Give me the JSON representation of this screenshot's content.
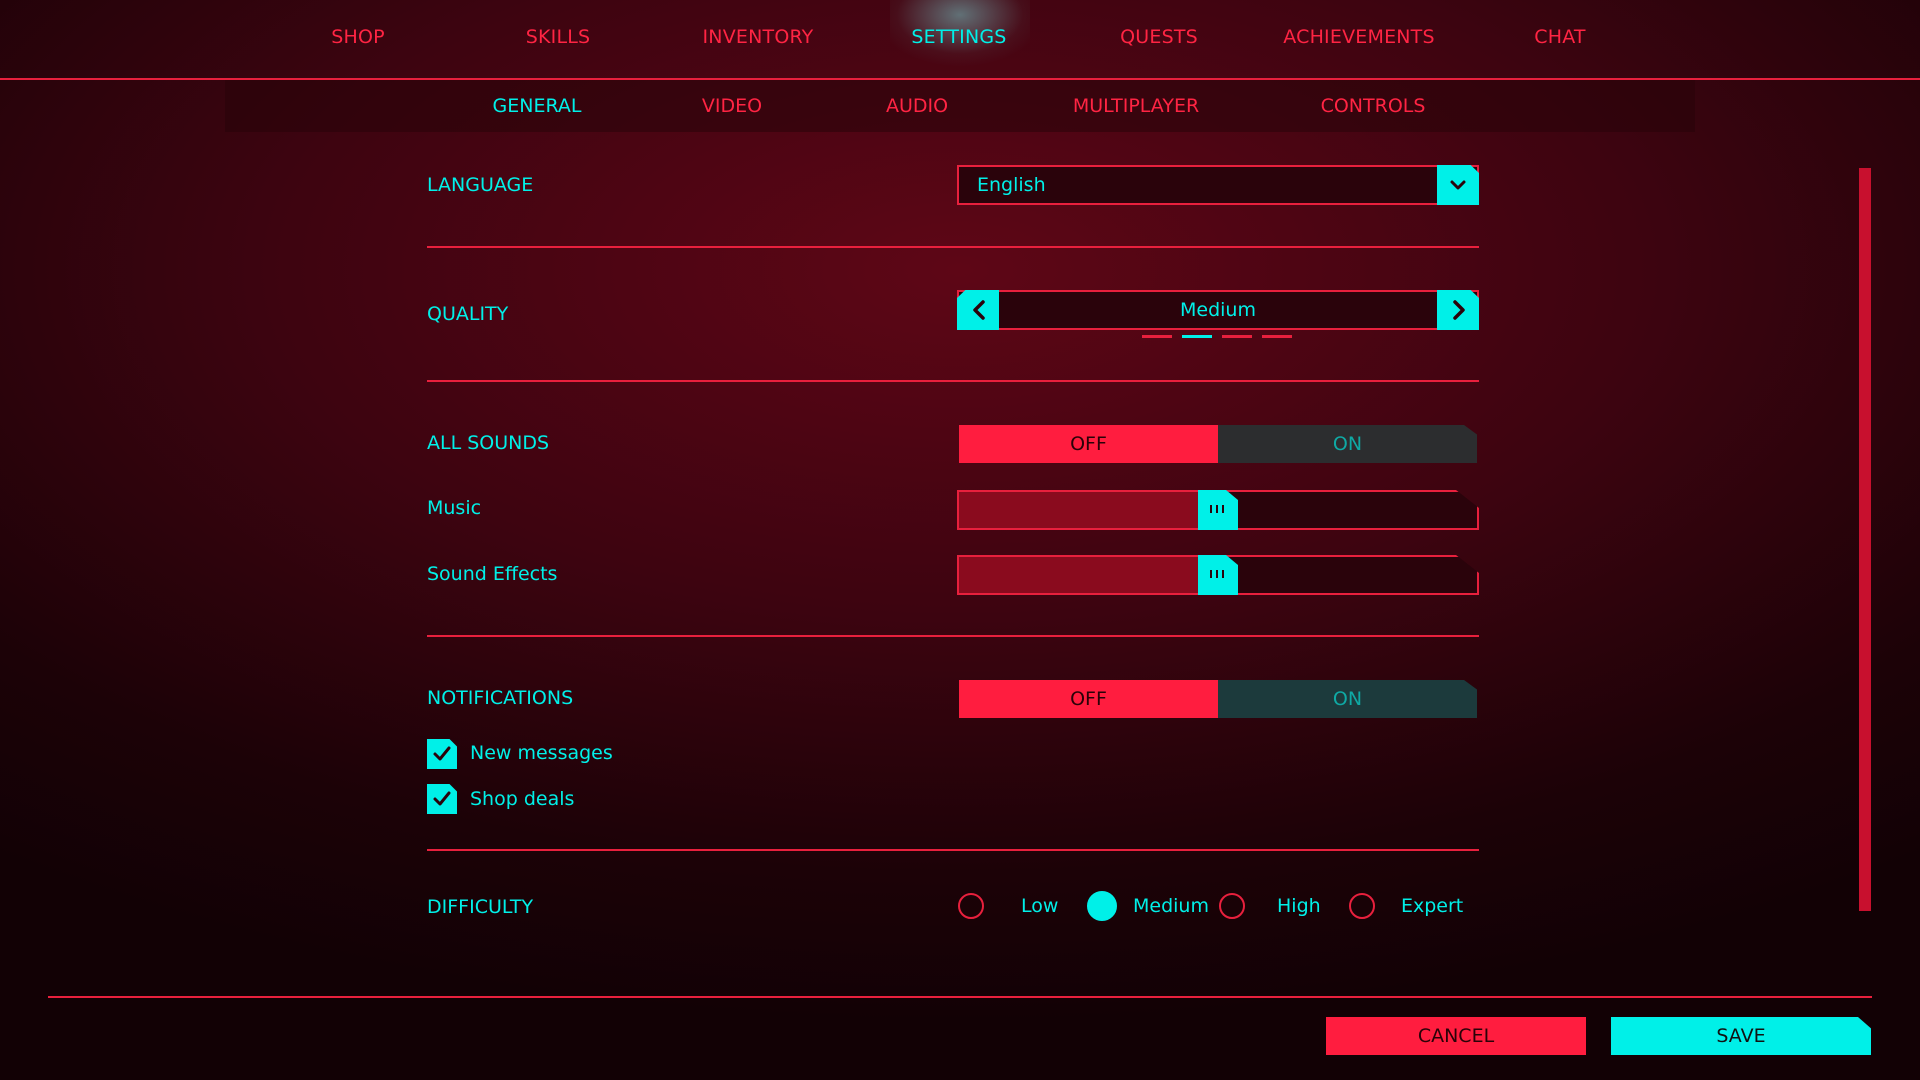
{
  "top_nav": {
    "items": [
      "SHOP",
      "SKILLS",
      "INVENTORY",
      "SETTINGS",
      "QUESTS",
      "ACHIEVEMENTS",
      "CHAT"
    ],
    "active": "SETTINGS"
  },
  "sub_nav": {
    "items": [
      "GENERAL",
      "VIDEO",
      "AUDIO",
      "MULTIPLAYER",
      "CONTROLS"
    ],
    "active": "GENERAL"
  },
  "settings": {
    "language": {
      "label": "LANGUAGE",
      "value": "English",
      "icon": "chevron-down-icon"
    },
    "quality": {
      "label": "QUALITY",
      "value": "Medium",
      "level_index": 1,
      "level_count": 4
    },
    "all_sounds": {
      "label": "ALL SOUNDS",
      "off_label": "OFF",
      "on_label": "ON",
      "state": "OFF"
    },
    "music": {
      "label": "Music",
      "level_percent": 50
    },
    "sound_effects": {
      "label": "Sound Effects",
      "level_percent": 50
    },
    "notifications": {
      "label": "NOTIFICATIONS",
      "off_label": "OFF",
      "on_label": "ON",
      "state": "OFF"
    },
    "new_messages": {
      "label": "New messages",
      "checked": true
    },
    "shop_deals": {
      "label": "Shop deals",
      "checked": true
    },
    "difficulty": {
      "label": "DIFFICULTY",
      "options": [
        "Low",
        "Medium",
        "High",
        "Expert"
      ],
      "selected": "Medium"
    }
  },
  "footer": {
    "cancel_label": "CANCEL",
    "save_label": "SAVE"
  },
  "colors": {
    "accent_cyan": "#00f0e8",
    "accent_red": "#ff1d3f",
    "background": "#3d0410"
  }
}
